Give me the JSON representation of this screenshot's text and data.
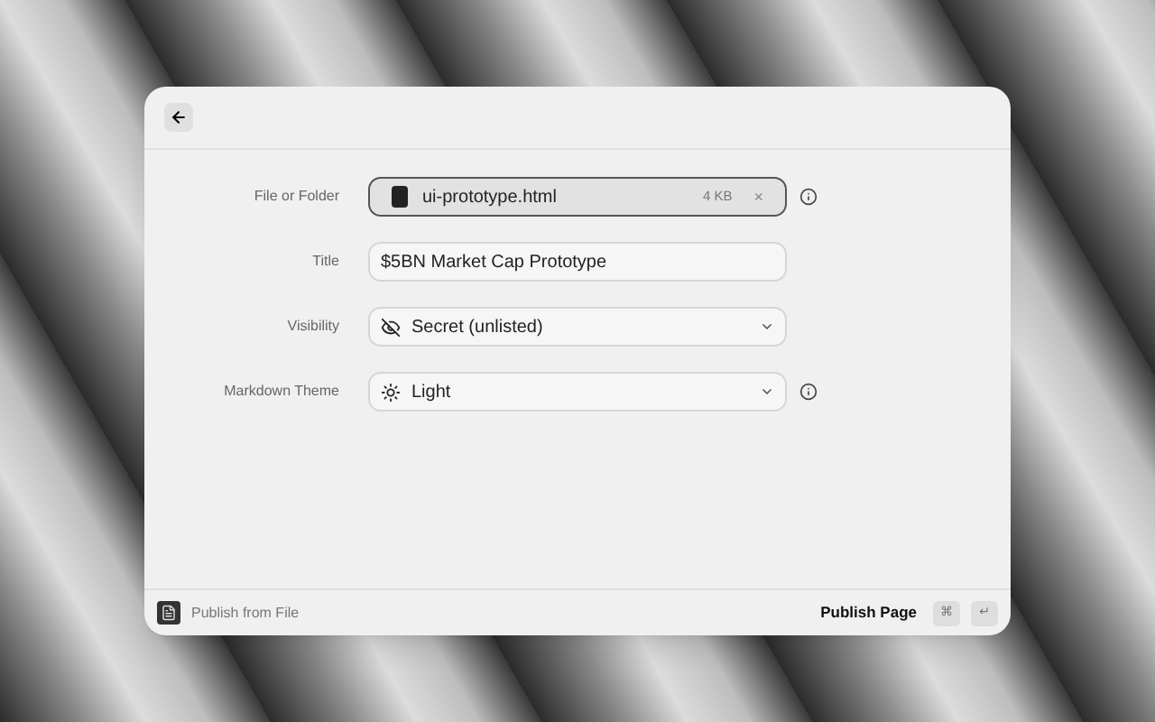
{
  "fields": [
    {
      "kind": "file",
      "label": "File or Folder",
      "value": "ui-prototype.html",
      "size": "4 KB",
      "remove": "×",
      "info": true
    },
    {
      "kind": "text",
      "label": "Title",
      "value": "$5BN Market Cap Prototype",
      "info": false
    },
    {
      "kind": "visibility",
      "label": "Visibility",
      "value": "Secret (unlisted)",
      "info": false
    },
    {
      "kind": "theme",
      "label": "Markdown Theme",
      "value": "Light",
      "info": true
    }
  ],
  "footer": {
    "source": "Publish from File",
    "action": "Publish Page",
    "keys": [
      "⌘",
      "↵"
    ]
  }
}
